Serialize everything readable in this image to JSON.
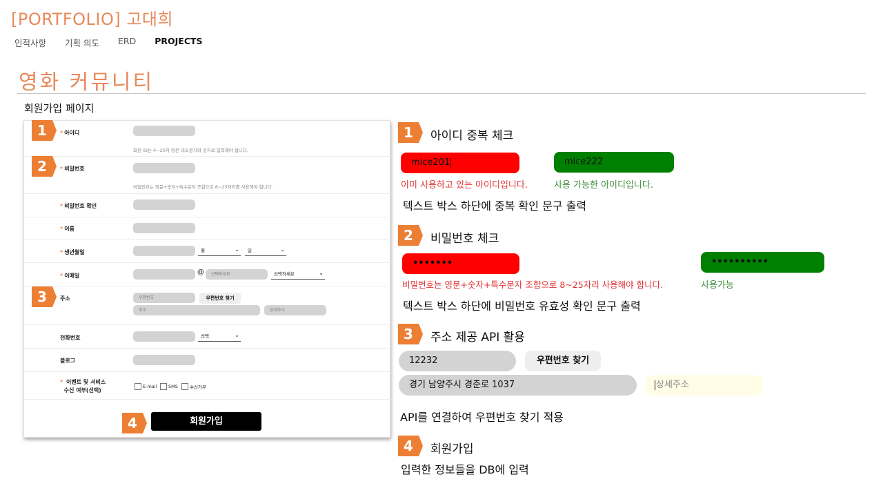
{
  "site": {
    "title": "[PORTFOLIO] 고대희"
  },
  "nav": [
    "인적사항",
    "기획 의도",
    "ERD",
    "PROJECTS"
  ],
  "page_title": "영화 커뮤니티",
  "section_label": "회원가입 페이지",
  "form": {
    "id_label": "아이디",
    "id_hint": "회원 ID는 4~20자 영문 대소문자와 숫자로 입력해야 합니다.",
    "pw_label": "비밀번호",
    "pw_hint": "비밀번호는 영문+숫자+특수문자 조합으로 8~25자리를 사용해야 합니다.",
    "pw_confirm_label": "비밀번호 확인",
    "name_label": "이름",
    "birth_label": "생년월일",
    "birth_month": "월",
    "birth_day": "일",
    "email_label": "이메일",
    "email_at": "@",
    "email_domain_placeholder": "선택하세요",
    "email_select": "선택하세요",
    "address_label": "주소",
    "zip_placeholder": "우편번호",
    "zip_button": "우편번호 찾기",
    "addr_placeholder": "주소",
    "addr_detail_placeholder": "상세주소",
    "phone_label": "전화번호",
    "phone_select": "선택",
    "blog_label": "블로그",
    "events_label_1": "이벤트 및 서비스",
    "events_label_2": "수신 여부(선택)",
    "opt_email": "E-mail",
    "opt_sms": "SMS",
    "opt_reject": "수신거부",
    "submit": "회원가입"
  },
  "badges": [
    "1",
    "2",
    "3",
    "4"
  ],
  "steps": {
    "s1": {
      "title": "아이디 중복 체크",
      "bad_value": "mice201",
      "good_value": "mice222",
      "bad_msg": "이미 사용하고 있는 아이디입니다.",
      "good_msg": "사용 가능한 아이디입니다.",
      "desc": "텍스트 박스 하단에 중복 확인 문구 출력"
    },
    "s2": {
      "title": "비밀번호 체크",
      "bad_value": "•••••••",
      "good_value": "••••••••••",
      "bad_msg": "비밀번호는 영문+숫자+특수문자 조합으로 8~25자리 사용해야 합니다.",
      "good_msg": "사용가능",
      "desc": "텍스트 박스 하단에 비밀번호 유효성 확인 문구 출력"
    },
    "s3": {
      "title": "주소 제공 API 활용",
      "zip_value": "12232",
      "zip_button": "우편번호 찾기",
      "addr_value": "경기 남양주시 경춘로 1037",
      "detail_placeholder": "상세주소",
      "desc": "API를 연결하여 우편번호 찾기 적용"
    },
    "s4": {
      "title": "회원가입",
      "desc": "입력한 정보들을 DB에 입력"
    }
  },
  "colors": {
    "accent": "#e8895a",
    "badge": "#ec7f34",
    "error": "#ff0000",
    "success": "#008000"
  }
}
